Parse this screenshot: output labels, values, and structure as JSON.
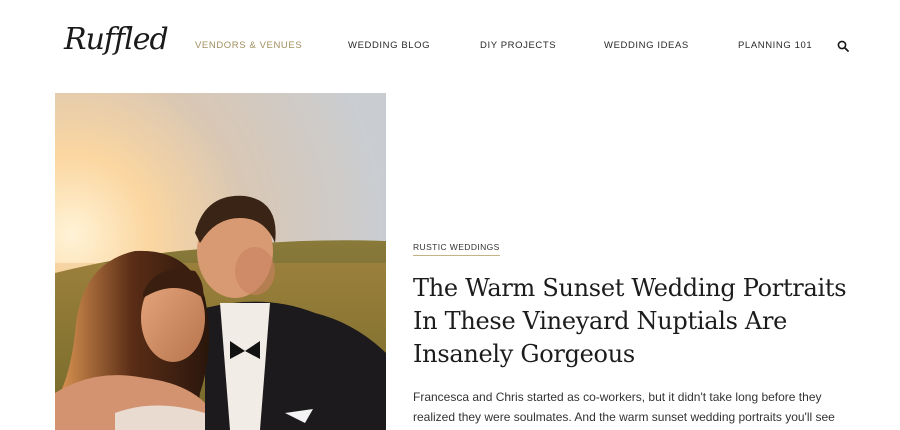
{
  "header": {
    "logo_text": "Ruffled",
    "nav": [
      {
        "label": "Vendors & Venues",
        "active": true
      },
      {
        "label": "Wedding Blog",
        "active": false
      },
      {
        "label": "DIY Projects",
        "active": false
      },
      {
        "label": "Wedding Ideas",
        "active": false
      },
      {
        "label": "Planning 101",
        "active": false
      }
    ],
    "search_icon": "search-icon"
  },
  "colors": {
    "accent": "#a08f5e",
    "underline": "#c2b486"
  },
  "feature": {
    "category": "Rustic Weddings",
    "title": "The Warm Sunset Wedding Portraits In These Vineyard Nuptials Are Insanely Gorgeous",
    "excerpt": "Francesca and Chris started as co-workers, but it didn't take long before they realized they were soulmates. And the warm sunset wedding portraits you'll see towards the end of this story are..."
  }
}
